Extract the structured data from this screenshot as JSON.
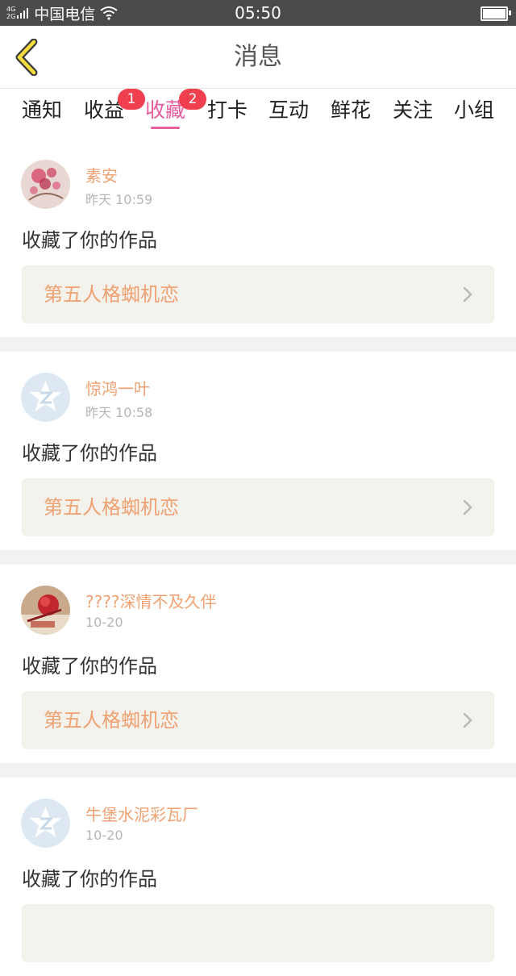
{
  "status_bar": {
    "network_top": "4G",
    "network_bottom": "2G",
    "carrier": "中国电信",
    "time": "05:50"
  },
  "header": {
    "title": "消息"
  },
  "tabs": [
    {
      "label": "通知"
    },
    {
      "label": "收益",
      "badge": "1"
    },
    {
      "label": "收藏",
      "badge": "2",
      "active": true
    },
    {
      "label": "打卡"
    },
    {
      "label": "互动"
    },
    {
      "label": "鲜花"
    },
    {
      "label": "关注"
    },
    {
      "label": "小组"
    }
  ],
  "colors": {
    "accent": "#e85d9c",
    "name_orange": "#f0a171",
    "badge_red": "#f0404f",
    "card_bg": "#f3f2ec"
  },
  "messages": [
    {
      "username": "素安",
      "time": "昨天 10:59",
      "action": "收藏了你的作品",
      "work_title": "第五人格蜘机恋",
      "avatar": "flower-avatar"
    },
    {
      "username": "惊鸿一叶",
      "time": "昨天 10:58",
      "action": "收藏了你的作品",
      "work_title": "第五人格蜘机恋",
      "avatar": "default-star-avatar"
    },
    {
      "username": "????深情不及久伴",
      "time": "10-20",
      "action": "收藏了你的作品",
      "work_title": "第五人格蜘机恋",
      "avatar": "rose-avatar"
    },
    {
      "username": "牛堡水泥彩瓦厂",
      "time": "10-20",
      "action": "收藏了你的作品",
      "work_title": "",
      "avatar": "default-star-avatar"
    }
  ]
}
